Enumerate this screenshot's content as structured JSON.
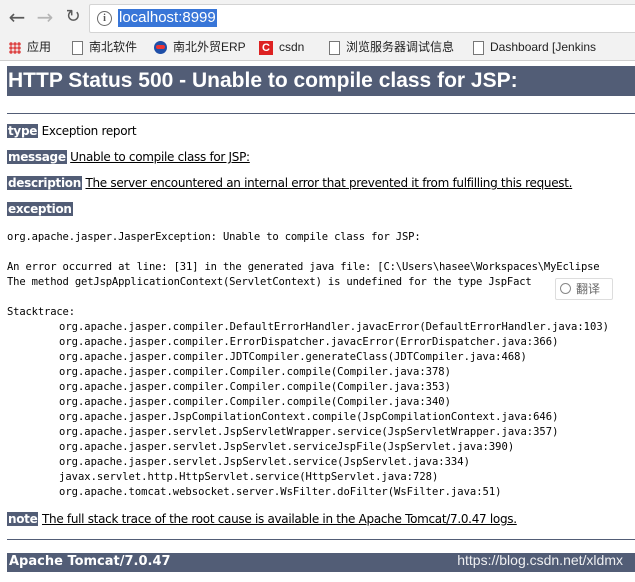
{
  "browser": {
    "url": "localhost:8999",
    "bookmarks": [
      "应用",
      "南北软件",
      "南北外贸ERP",
      "csdn",
      "浏览服务器调试信息",
      "Dashboard [Jenkins"
    ]
  },
  "page": {
    "title": "HTTP Status 500 - Unable to compile class for JSP:",
    "type_label": "type",
    "type_value": "Exception report",
    "message_label": "message",
    "message_value": "Unable to compile class for JSP:",
    "description_label": "description",
    "description_value": "The server encountered an internal error that prevented it from fulfilling this request.",
    "exception_label": "exception",
    "exception_line": "org.apache.jasper.JasperException: Unable to compile class for JSP:",
    "error_line1": "An error occurred at line: [31] in the generated java file: [C:\\Users\\hasee\\Workspaces\\MyEclipse",
    "error_line2": "The method getJspApplicationContext(ServletContext) is undefined for the type JspFact",
    "stacktrace_label": "Stacktrace:",
    "stacktrace": [
      "org.apache.jasper.compiler.DefaultErrorHandler.javacError(DefaultErrorHandler.java:103)",
      "org.apache.jasper.compiler.ErrorDispatcher.javacError(ErrorDispatcher.java:366)",
      "org.apache.jasper.compiler.JDTCompiler.generateClass(JDTCompiler.java:468)",
      "org.apache.jasper.compiler.Compiler.compile(Compiler.java:378)",
      "org.apache.jasper.compiler.Compiler.compile(Compiler.java:353)",
      "org.apache.jasper.compiler.Compiler.compile(Compiler.java:340)",
      "org.apache.jasper.JspCompilationContext.compile(JspCompilationContext.java:646)",
      "org.apache.jasper.servlet.JspServletWrapper.service(JspServletWrapper.java:357)",
      "org.apache.jasper.servlet.JspServlet.serviceJspFile(JspServlet.java:390)",
      "org.apache.jasper.servlet.JspServlet.service(JspServlet.java:334)",
      "javax.servlet.http.HttpServlet.service(HttpServlet.java:728)",
      "org.apache.tomcat.websocket.server.WsFilter.doFilter(WsFilter.java:51)"
    ],
    "note_label": "note",
    "note_value": "The full stack trace of the root cause is available in the Apache Tomcat/7.0.47 logs.",
    "footer": "Apache Tomcat/7.0.47"
  },
  "overlay": {
    "translate_label": "翻译",
    "watermark": "https://blog.csdn.net/xldmx"
  },
  "colors": {
    "header_bg": "#525d76",
    "url_highlight": "#3876d8"
  },
  "icons": [
    "back-arrow-icon",
    "forward-arrow-icon",
    "reload-icon",
    "info-icon",
    "apps-icon",
    "document-icon",
    "nanbei-logo-icon",
    "csdn-icon",
    "translate-search-icon"
  ]
}
